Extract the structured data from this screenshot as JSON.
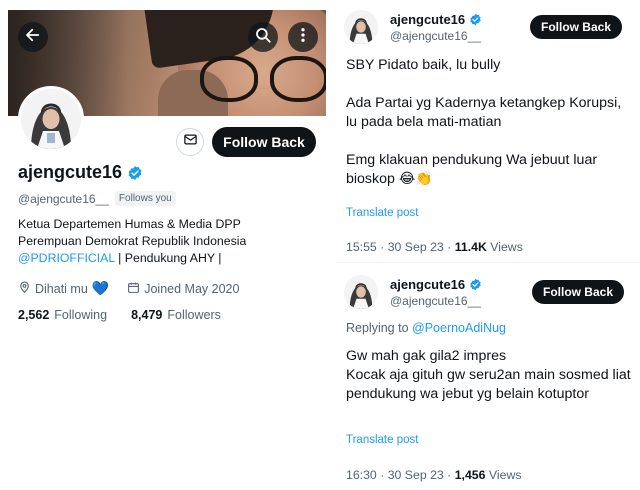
{
  "profile": {
    "name": "ajengcute16",
    "handle": "@ajengcute16__",
    "follows_you": "Follows you",
    "follow_back_label": "Follow Back",
    "bio_line1": "Ketua Departemen Humas & Media DPP",
    "bio_line2": "Perempuan Demokrat Republik Indonesia",
    "bio_mention": "@PDRIOFFICIAL",
    "bio_tail": " | Pendukung AHY |",
    "location": "Dihati mu",
    "location_emoji": "💙",
    "joined": "Joined May 2020",
    "following_count": "2,562",
    "following_label": "Following",
    "followers_count": "8,479",
    "followers_label": "Followers"
  },
  "icons": {
    "back": "arrow-left-icon",
    "search": "search-icon",
    "more": "more-vertical-icon",
    "mail": "mail-icon",
    "verified": "verified-badge-icon",
    "location": "location-pin-icon",
    "calendar": "calendar-icon"
  },
  "tweets": [
    {
      "name": "ajengcute16",
      "handle": "@ajengcute16__",
      "follow_back_label": "Follow Back",
      "lines": [
        "SBY Pidato baik, lu bully",
        "Ada Partai yg Kadernya  ketangkep Korupsi, lu pada bela mati-matian",
        "Emg klakuan pendukung Wa jebuut luar bioskop"
      ],
      "emoji": "😂👏",
      "translate_label": "Translate post",
      "time": "15:55 · 30 Sep 23 · ",
      "views_count": "11.4K",
      "views_label": " Views"
    },
    {
      "name": "ajengcute16",
      "handle": "@ajengcute16__",
      "follow_back_label": "Follow Back",
      "replying_prefix": "Replying to ",
      "replying_to": "@PoernoAdiNug",
      "text": "Gw mah gak gila2 impres\nKocak aja gituh gw seru2an main sosmed liat pendukung wa jebut yg belain kotuptor",
      "translate_label": "Translate post",
      "time": "16:30 · 30 Sep 23 · ",
      "views_count": "1,456",
      "views_label": " Views"
    }
  ],
  "colors": {
    "accent": "#1d9bf0",
    "text": "#0f1419",
    "muted": "#536471",
    "button_bg": "#0f1419"
  }
}
